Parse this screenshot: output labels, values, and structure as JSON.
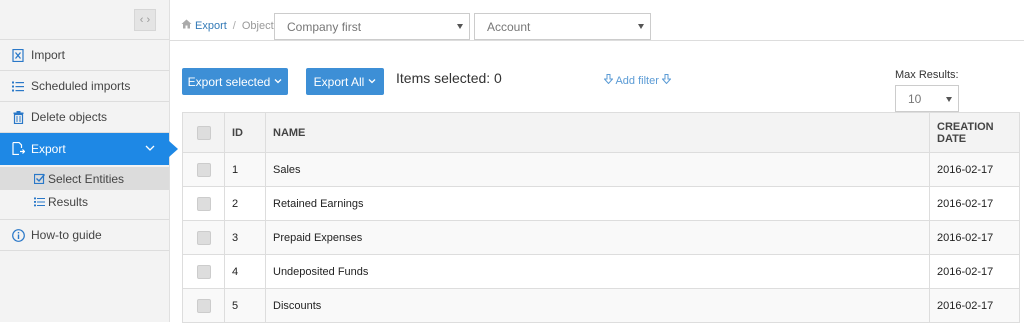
{
  "sidebar": {
    "collapse_label": "‹ ›",
    "items": [
      {
        "label": "Import",
        "icon": "file-excel-icon"
      },
      {
        "label": "Scheduled imports",
        "icon": "list-icon"
      },
      {
        "label": "Delete objects",
        "icon": "trash-icon"
      },
      {
        "label": "Export",
        "icon": "export-file-icon",
        "active": true
      },
      {
        "label": "How-to guide",
        "icon": "info-icon"
      }
    ],
    "sub_items": [
      {
        "label": "Select Entities",
        "icon": "checkbox-checked-icon",
        "selected": true
      },
      {
        "label": "Results",
        "icon": "list-icon"
      }
    ]
  },
  "breadcrumb": {
    "home_label": "Export",
    "current": "Object"
  },
  "filters": {
    "company": "Company first",
    "object": "Account"
  },
  "toolbar": {
    "export_selected_label": "Export selected",
    "export_all_label": "Export All",
    "items_selected_text": "Items selected: 0",
    "add_filter_label": "Add filter",
    "max_results_label": "Max Results:",
    "max_results_value": "10"
  },
  "table": {
    "columns": [
      "ID",
      "NAME",
      "CREATION DATE"
    ],
    "rows": [
      {
        "id": "1",
        "name": "Sales",
        "date": "2016-02-17"
      },
      {
        "id": "2",
        "name": "Retained Earnings",
        "date": "2016-02-17"
      },
      {
        "id": "3",
        "name": "Prepaid Expenses",
        "date": "2016-02-17"
      },
      {
        "id": "4",
        "name": "Undeposited Funds",
        "date": "2016-02-17"
      },
      {
        "id": "5",
        "name": "Discounts",
        "date": "2016-02-17"
      }
    ]
  },
  "colors": {
    "accent": "#1e88e5",
    "button": "#3d8fd6",
    "link": "#337ab7"
  }
}
